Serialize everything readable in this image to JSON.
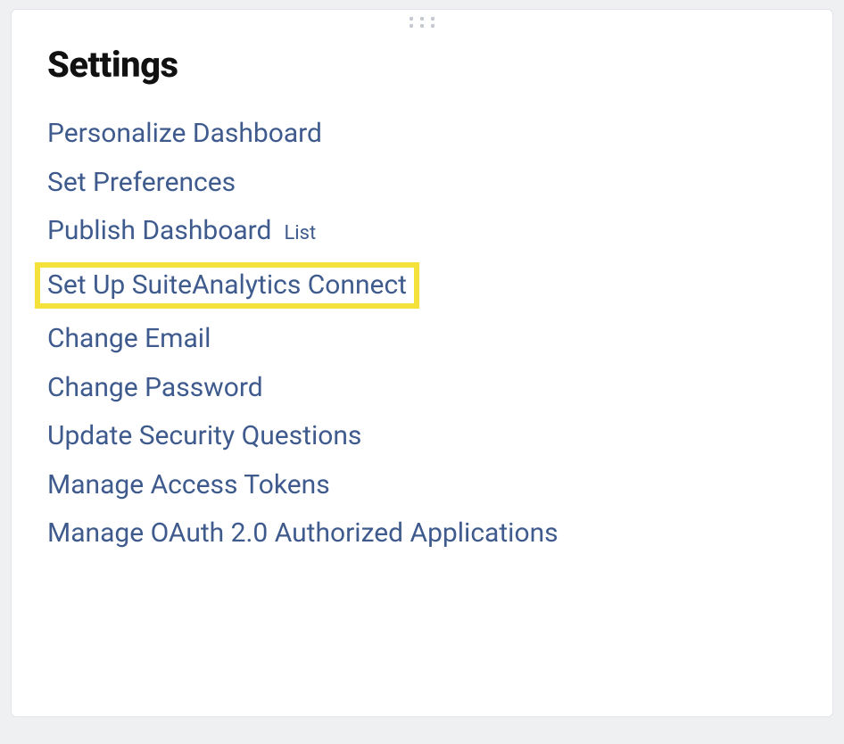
{
  "panel": {
    "title": "Settings",
    "items": [
      {
        "label": "Personalize Dashboard",
        "sub": null,
        "highlighted": false,
        "name": "settings-item-personalize-dashboard"
      },
      {
        "label": "Set Preferences",
        "sub": null,
        "highlighted": false,
        "name": "settings-item-set-preferences"
      },
      {
        "label": "Publish Dashboard",
        "sub": "List",
        "highlighted": false,
        "name": "settings-item-publish-dashboard"
      },
      {
        "label": "Set Up SuiteAnalytics Connect",
        "sub": null,
        "highlighted": true,
        "name": "settings-item-suiteanalytics-connect"
      },
      {
        "label": "Change Email",
        "sub": null,
        "highlighted": false,
        "name": "settings-item-change-email"
      },
      {
        "label": "Change Password",
        "sub": null,
        "highlighted": false,
        "name": "settings-item-change-password"
      },
      {
        "label": "Update Security Questions",
        "sub": null,
        "highlighted": false,
        "name": "settings-item-update-security-questions"
      },
      {
        "label": "Manage Access Tokens",
        "sub": null,
        "highlighted": false,
        "name": "settings-item-manage-access-tokens"
      },
      {
        "label": "Manage OAuth 2.0 Authorized Applications",
        "sub": null,
        "highlighted": false,
        "name": "settings-item-manage-oauth"
      }
    ]
  },
  "colors": {
    "link": "#3f5b8e",
    "highlight_border": "#f5e13c",
    "background": "#eef0f2",
    "panel_bg": "#ffffff"
  }
}
